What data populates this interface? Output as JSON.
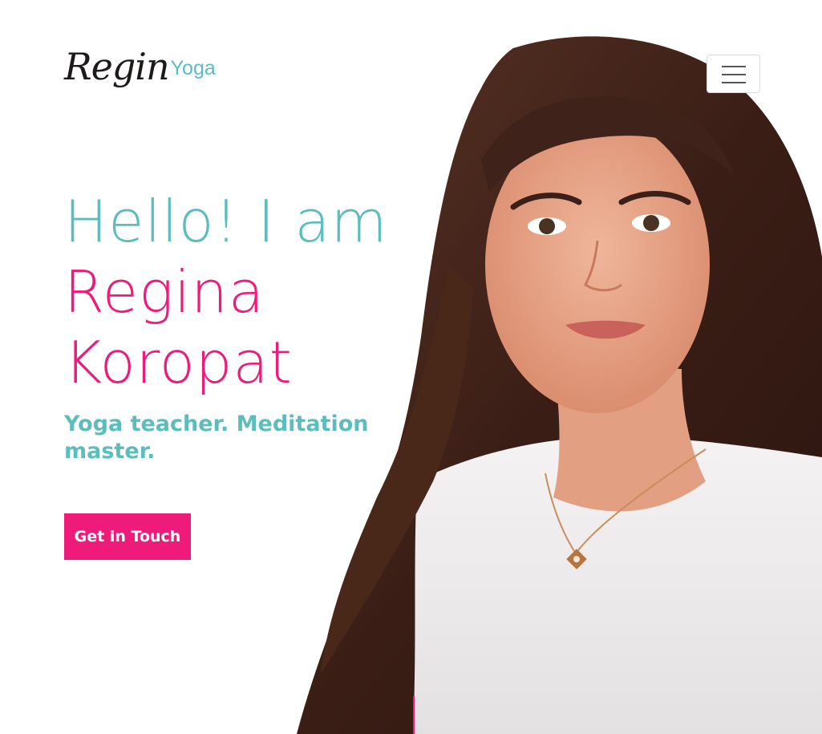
{
  "header": {
    "logo_script": "Regin",
    "logo_suffix": "Yoga"
  },
  "hero": {
    "headline_line1": "Hello! I am",
    "headline_line2": "Regina",
    "headline_line3": "Koropat",
    "tagline": "Yoga teacher. Meditation master.",
    "cta_label": "Get in Touch"
  },
  "colors": {
    "teal": "#5cbdbd",
    "pink": "#ee1b7b",
    "text_dark": "#1e1a1a"
  }
}
